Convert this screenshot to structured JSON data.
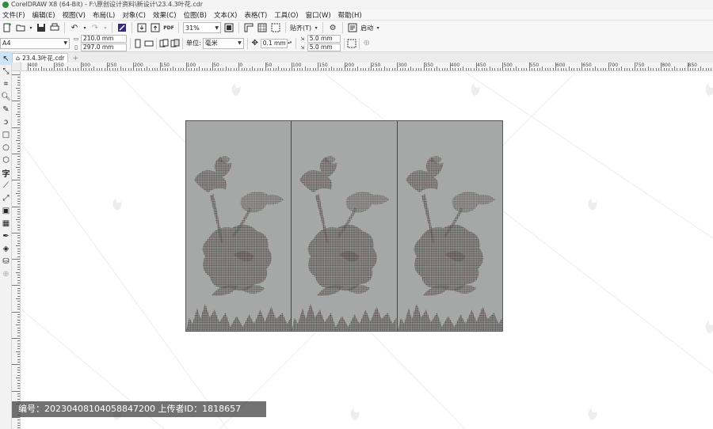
{
  "window": {
    "title": "CorelDRAW X8 (64-Bit) - F:\\原创设计资料\\新设计\\23.4.3叶花.cdr"
  },
  "menu": [
    {
      "label": "文件(F)"
    },
    {
      "label": "编辑(E)"
    },
    {
      "label": "视图(V)"
    },
    {
      "label": "布局(L)"
    },
    {
      "label": "对象(C)"
    },
    {
      "label": "效果(C)"
    },
    {
      "label": "位图(B)"
    },
    {
      "label": "文本(X)"
    },
    {
      "label": "表格(T)"
    },
    {
      "label": "工具(O)"
    },
    {
      "label": "窗口(W)"
    },
    {
      "label": "帮助(H)"
    }
  ],
  "toolbar": {
    "zoom_value": "31%",
    "snap_label": "贴齐(T)",
    "launch_label": "启动",
    "pdf_label": "PDF"
  },
  "property_bar": {
    "page_size": "A4",
    "width": "210.0 mm",
    "height": "297.0 mm",
    "unit_label": "单位:",
    "unit_value": "毫米",
    "nudge": "0.1 mm",
    "dup_x": "5.0 mm",
    "dup_y": "5.0 mm"
  },
  "document_tab": {
    "label": "23.4.3叶花.cdr"
  },
  "ruler": {
    "h_labels": [
      "400",
      "350",
      "300",
      "250",
      "200",
      "150",
      "100",
      "50",
      "0",
      "50",
      "100",
      "150",
      "200",
      "250",
      "300",
      "350",
      "400",
      "450",
      "500",
      "550",
      "600",
      "650",
      "700",
      "750",
      "800",
      "850"
    ]
  },
  "badge": {
    "text": "编号：20230408104058847200  上传者ID：1818657"
  },
  "colors": {
    "panel_bg": "#a5a8a6",
    "flower_dark": "#4a4040",
    "selection": "#cde4f7"
  }
}
